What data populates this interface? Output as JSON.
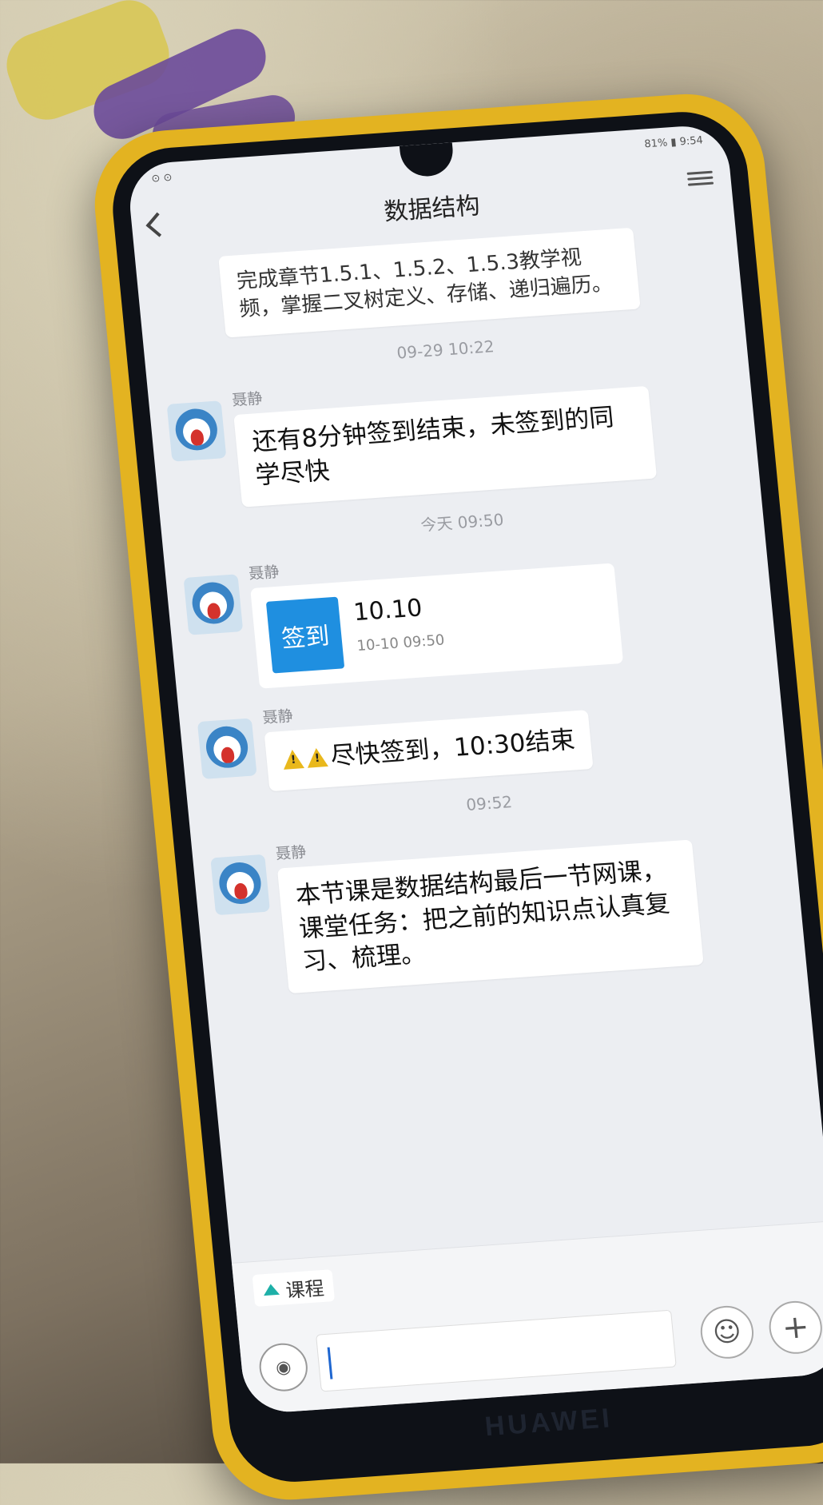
{
  "device": {
    "brand": "HUAWEI"
  },
  "status_bar": {
    "left": "⊙ ⊙",
    "right": "81% ▮ 9:54"
  },
  "header": {
    "title": "数据结构"
  },
  "messages": [
    {
      "type": "text-partial",
      "text": "完成章节1.5.1、1.5.2、1.5.3教学视频，掌握二叉树定义、存储、递归遍历。"
    },
    {
      "type": "time",
      "text": "09-29 10:22"
    },
    {
      "type": "text",
      "sender": "聂静",
      "text": "还有8分钟签到结束，未签到的同学尽快"
    },
    {
      "type": "time",
      "text": "今天 09:50"
    },
    {
      "type": "card",
      "sender": "聂静",
      "icon_label": "签到",
      "title": "10.10",
      "subtitle": "10-10 09:50"
    },
    {
      "type": "warn",
      "sender": "聂静",
      "text": "尽快签到，10:30结束"
    },
    {
      "type": "time",
      "text": "09:52"
    },
    {
      "type": "text",
      "sender": "聂静",
      "text": "本节课是数据结构最后一节网课，课堂任务：把之前的知识点认真复习、梳理。"
    }
  ],
  "footer": {
    "course_tab": "课程",
    "input_value": ""
  },
  "icons": {
    "back": "back-arrow-icon",
    "menu": "menu-icon",
    "voice": "voice-icon",
    "emoji": "smiley-icon",
    "plus": "plus-icon"
  },
  "colors": {
    "case": "#e3b321",
    "card_icon": "#1f8fe0",
    "warn": "#e9b81c"
  }
}
